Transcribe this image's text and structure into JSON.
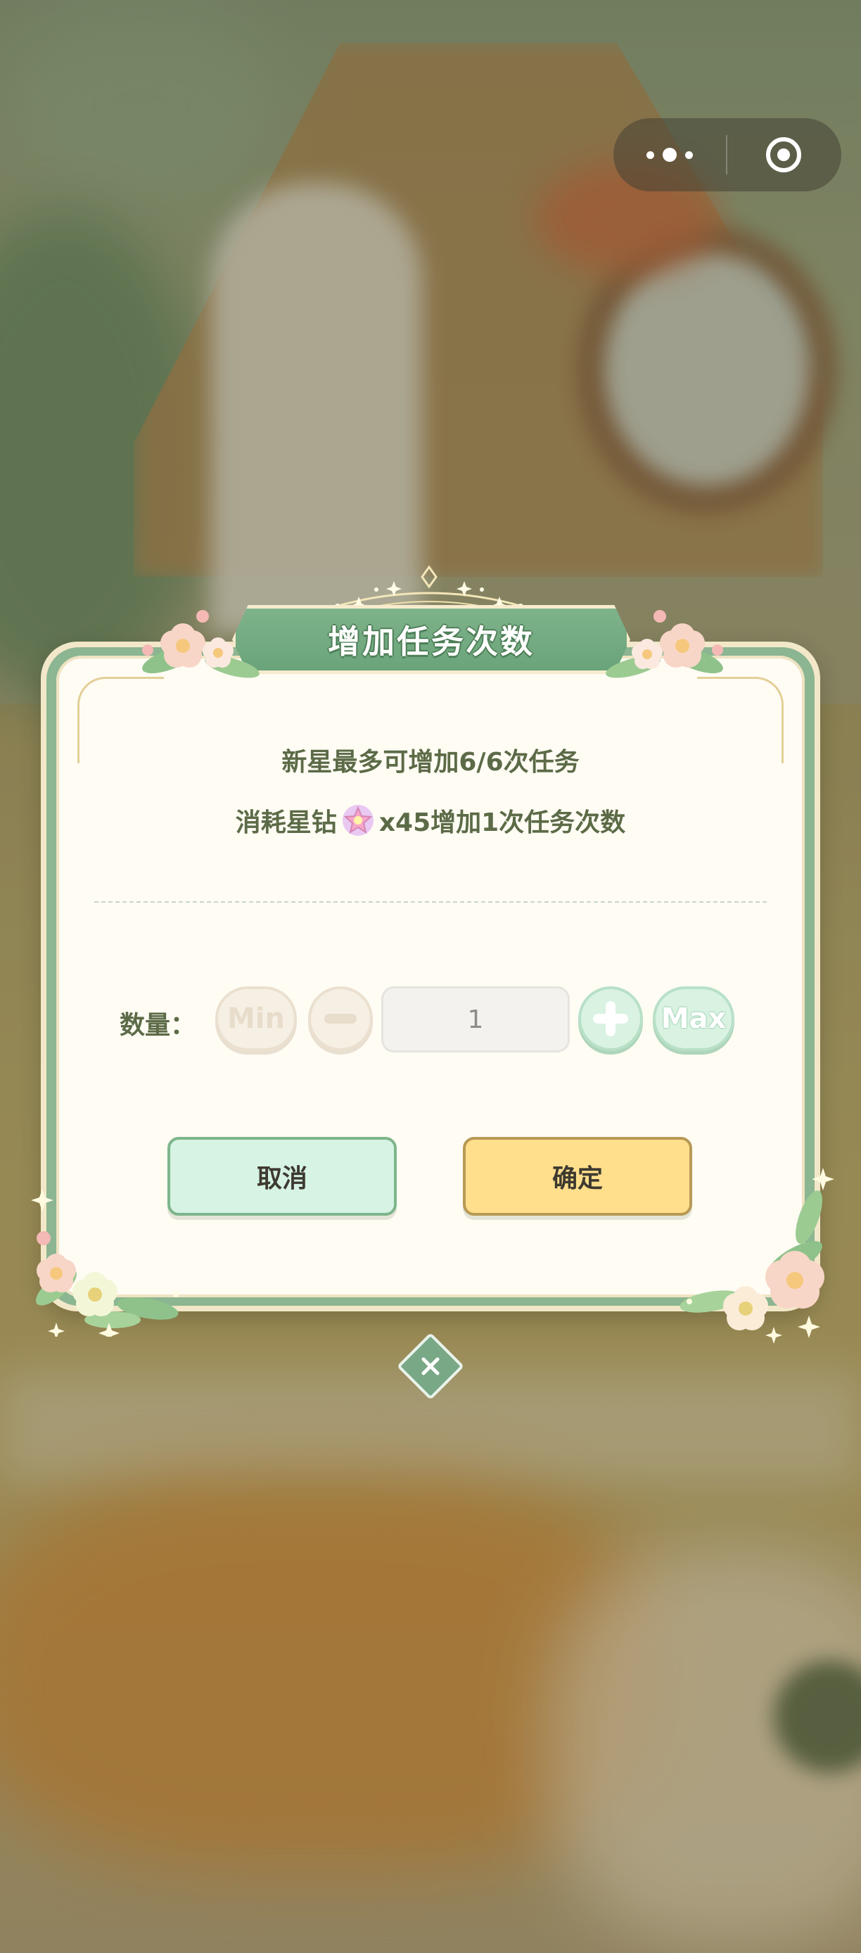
{
  "capsule": {
    "more_icon": "more-dots-icon",
    "close_icon": "target-icon"
  },
  "dialog": {
    "title": "增加任务次数",
    "info_line_1": "新星最多可增加6/6次任务",
    "info_line_2_prefix": "消耗星钻",
    "info_line_2_icon": "star-gem-icon",
    "info_line_2_suffix": "x45增加1次任务次数",
    "quantity_label": "数量：",
    "min_label": "Min",
    "max_label": "Max",
    "quantity_value": "1",
    "cancel_label": "取消",
    "confirm_label": "确定",
    "close_icon": "close-icon"
  },
  "colors": {
    "accent_green": "#6aa37a",
    "panel_bg": "#fffcf4",
    "text": "#5c6b47",
    "confirm_bg": "#ffdf8c",
    "cancel_bg": "#d6f3e3"
  }
}
